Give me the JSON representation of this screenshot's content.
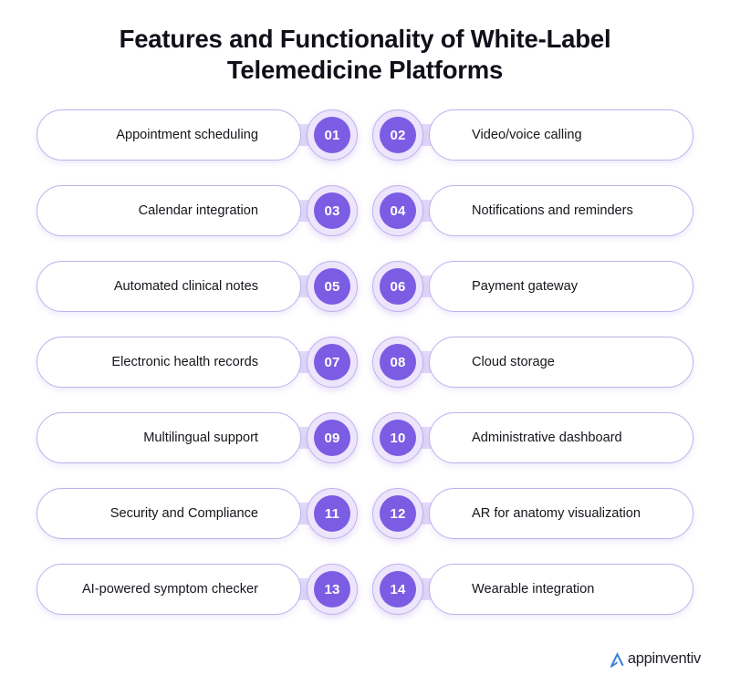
{
  "header": {
    "title": "Features and Functionality of White-Label Telemedicine Platforms"
  },
  "colors": {
    "badge_fill": "#7b5ce3",
    "badge_ring": "#ece5fb",
    "border": "#c2b0ec",
    "connector": "#e3dcf8",
    "text": "#15151c",
    "background": "#ffffff",
    "logo_mark": "#3b82d6"
  },
  "rows": [
    {
      "left": {
        "number": "01",
        "label": "Appointment scheduling"
      },
      "right": {
        "number": "02",
        "label": "Video/voice calling"
      }
    },
    {
      "left": {
        "number": "03",
        "label": "Calendar integration"
      },
      "right": {
        "number": "04",
        "label": "Notifications and reminders"
      }
    },
    {
      "left": {
        "number": "05",
        "label": "Automated clinical notes"
      },
      "right": {
        "number": "06",
        "label": "Payment gateway"
      }
    },
    {
      "left": {
        "number": "07",
        "label": "Electronic health records"
      },
      "right": {
        "number": "08",
        "label": "Cloud storage"
      }
    },
    {
      "left": {
        "number": "09",
        "label": "Multilingual support"
      },
      "right": {
        "number": "10",
        "label": "Administrative dashboard"
      }
    },
    {
      "left": {
        "number": "11",
        "label": "Security and Compliance"
      },
      "right": {
        "number": "12",
        "label": "AR for anatomy visualization"
      }
    },
    {
      "left": {
        "number": "13",
        "label": "AI-powered symptom checker"
      },
      "right": {
        "number": "14",
        "label": "Wearable integration"
      }
    }
  ],
  "footer": {
    "logo_text": "appinventiv",
    "logo_icon": "appinventiv-a-mark-icon"
  }
}
